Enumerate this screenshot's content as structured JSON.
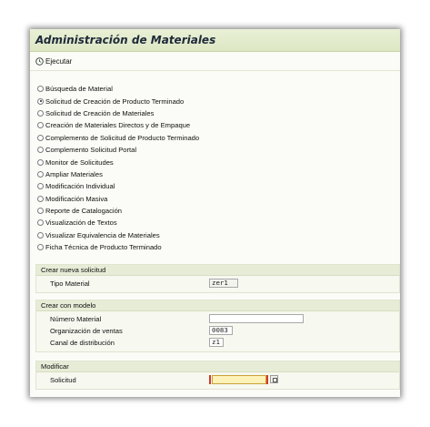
{
  "window": {
    "title": "Administración de Materiales"
  },
  "toolbar": {
    "execute_label": "Ejecutar",
    "execute_icon": "execute-clock-icon"
  },
  "options": [
    {
      "label": "Búsqueda de Material",
      "checked": false
    },
    {
      "label": "Solicitud de Creación de Producto Terminado",
      "checked": true
    },
    {
      "label": "Solicitud de Creación de Materiales",
      "checked": false
    },
    {
      "label": "Creación de Materiales Directos y de Empaque",
      "checked": false
    },
    {
      "label": "Complemento de Solicitud de Producto Terminado",
      "checked": false
    },
    {
      "label": "Complemento Solicitud Portal",
      "checked": false
    },
    {
      "label": "Monitor de Solicitudes",
      "checked": false
    },
    {
      "label": "Ampliar Materiales",
      "checked": false
    },
    {
      "label": "Modificación Individual",
      "checked": false
    },
    {
      "label": "Modificación Masiva",
      "checked": false
    },
    {
      "label": "Reporte de Catalogación",
      "checked": false
    },
    {
      "label": "Visualización de Textos",
      "checked": false
    },
    {
      "label": "Visualizar Equivalencia de Materiales",
      "checked": false
    },
    {
      "label": "Ficha Técnica de Producto Terminado",
      "checked": false
    }
  ],
  "groups": {
    "crear_nueva": {
      "title": "Crear nueva solicitud",
      "tipo_material_label": "Tipo Material",
      "tipo_material_value": "zer1"
    },
    "crear_modelo": {
      "title": "Crear con modelo",
      "numero_material_label": "Número Material",
      "numero_material_value": "",
      "org_ventas_label": "Organización de ventas",
      "org_ventas_value": "0083",
      "canal_label": "Canal de distribución",
      "canal_value": "z1"
    },
    "modificar": {
      "title": "Modificar",
      "solicitud_label": "Solicitud",
      "solicitud_value": ""
    }
  },
  "colors": {
    "title_bar": "#e3ebcd",
    "required_field": "#fff2b8",
    "required_marker": "#d33a2a"
  }
}
